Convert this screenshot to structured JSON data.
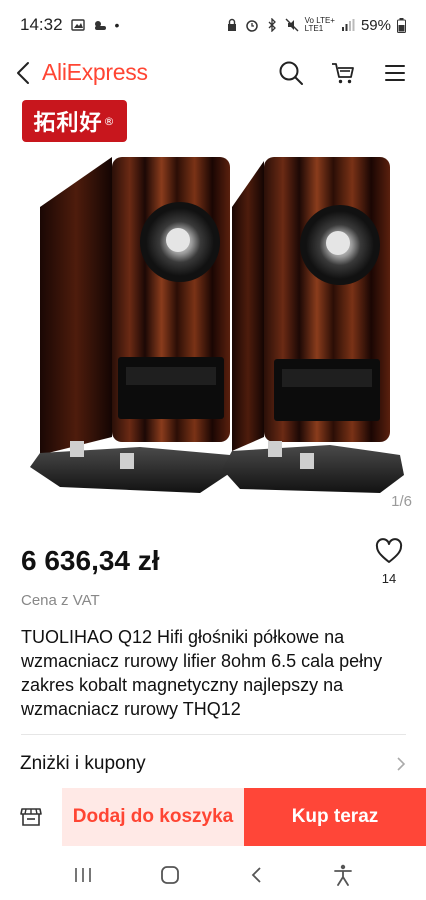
{
  "status_bar": {
    "time": "14:32",
    "carrier_line1": "Vo LTE+",
    "carrier_line2": "LTE1",
    "battery": "59%"
  },
  "app_bar": {
    "logo": "AliExpress",
    "icons": [
      "back-icon",
      "search-icon",
      "cart-icon",
      "menu-icon"
    ]
  },
  "gallery": {
    "brand_badge": "拓利好",
    "brand_badge_mark": "®",
    "page_indicator": "1/6"
  },
  "product": {
    "price": "6 636,34 zł",
    "vat_note": "Cena z VAT",
    "wishlist_count": "14",
    "title": "TUOLIHAO Q12 Hifi głośniki półkowe na wzmacniacz rurowy lifier 8ohm 6.5 cala pełny zakres kobalt magnetyczny najlepszy na wzmacniacz rurowy THQ12"
  },
  "coupons": {
    "label": "Zniżki i kupony"
  },
  "bottom_bar": {
    "add_to_cart": "Dodaj do koszyka",
    "buy_now": "Kup teraz"
  },
  "colors": {
    "brand": "#ff4533",
    "buy_button": "#ff4638",
    "cart_button_bg": "#ffe9e6",
    "badge_red": "#c8161d"
  }
}
